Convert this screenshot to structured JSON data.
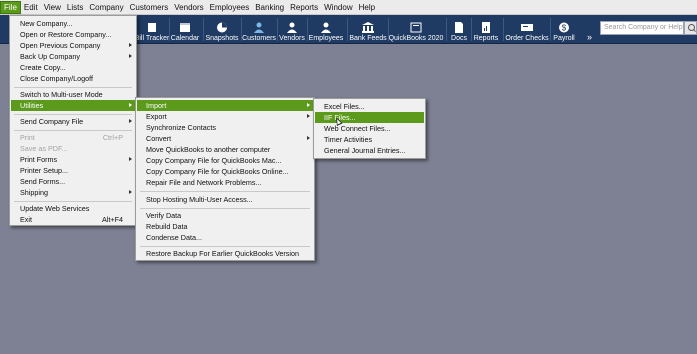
{
  "menubar": {
    "items": [
      "File",
      "Edit",
      "View",
      "Lists",
      "Company",
      "Customers",
      "Vendors",
      "Employees",
      "Banking",
      "Reports",
      "Window",
      "Help"
    ]
  },
  "toolbar": {
    "buttons": [
      {
        "label": "Bill Tracker",
        "icon": "bill-tracker-icon"
      },
      {
        "label": "Calendar",
        "icon": "calendar-icon"
      },
      {
        "label": "Snapshots",
        "icon": "pie-chart-icon"
      },
      {
        "label": "Customers",
        "icon": "customers-icon"
      },
      {
        "label": "Vendors",
        "icon": "vendors-icon"
      },
      {
        "label": "Employees",
        "icon": "employees-icon"
      },
      {
        "label": "Bank Feeds",
        "icon": "bank-icon"
      },
      {
        "label": "QuickBooks 2020",
        "icon": "quickbooks-icon"
      },
      {
        "label": "Docs",
        "icon": "docs-icon"
      },
      {
        "label": "Reports",
        "icon": "reports-icon"
      },
      {
        "label": "Order Checks",
        "icon": "order-checks-icon"
      },
      {
        "label": "Payroll",
        "icon": "payroll-icon"
      }
    ],
    "more": "»",
    "search_placeholder": "Search Company or Help"
  },
  "file_menu": {
    "items": [
      {
        "label": "New Company..."
      },
      {
        "label": "Open or Restore Company..."
      },
      {
        "label": "Open Previous Company",
        "submenu": true
      },
      {
        "label": "Back Up Company",
        "submenu": true
      },
      {
        "label": "Create Copy..."
      },
      {
        "label": "Close Company/Logoff"
      },
      {
        "label": "Switch to Multi-user Mode"
      },
      {
        "label": "Utilities",
        "submenu": true,
        "highlighted": true
      },
      {
        "label": "Send Company File",
        "submenu": true
      },
      {
        "label": "Print",
        "shortcut": "Ctrl+P",
        "disabled": true
      },
      {
        "label": "Save as PDF...",
        "disabled": true
      },
      {
        "label": "Print Forms",
        "submenu": true
      },
      {
        "label": "Printer Setup..."
      },
      {
        "label": "Send Forms..."
      },
      {
        "label": "Shipping",
        "submenu": true
      },
      {
        "label": "Update Web Services"
      },
      {
        "label": "Exit",
        "shortcut": "Alt+F4"
      }
    ]
  },
  "utilities_menu": {
    "items": [
      {
        "label": "Import",
        "submenu": true,
        "highlighted": true
      },
      {
        "label": "Export",
        "submenu": true
      },
      {
        "label": "Synchronize Contacts"
      },
      {
        "label": "Convert",
        "submenu": true
      },
      {
        "label": "Move QuickBooks to another computer"
      },
      {
        "label": "Copy Company File for QuickBooks Mac..."
      },
      {
        "label": "Copy Company File for QuickBooks Online..."
      },
      {
        "label": "Repair File and Network Problems..."
      },
      {
        "label": "Stop Hosting Multi-User Access..."
      },
      {
        "label": "Verify Data"
      },
      {
        "label": "Rebuild Data"
      },
      {
        "label": "Condense Data..."
      },
      {
        "label": "Restore Backup For Earlier QuickBooks Version"
      }
    ]
  },
  "import_menu": {
    "items": [
      {
        "label": "Excel Files..."
      },
      {
        "label": "IIF Files...",
        "highlighted": true
      },
      {
        "label": "Web Connect Files..."
      },
      {
        "label": "Timer Activities"
      },
      {
        "label": "General Journal Entries..."
      }
    ]
  },
  "colors": {
    "highlight": "#5c9a1c",
    "toolbar": "#1f3a63",
    "desktop": "#7d8193"
  }
}
